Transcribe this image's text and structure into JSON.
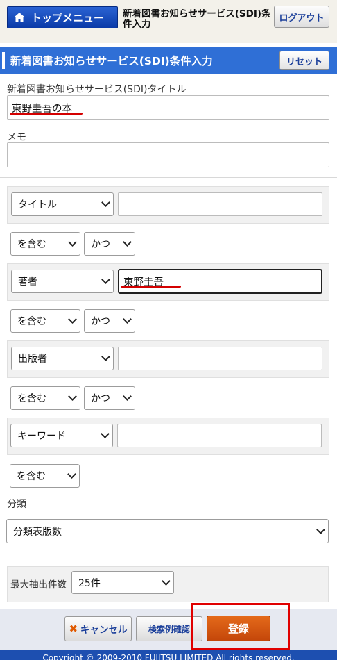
{
  "header": {
    "top_menu_label": "トップメニュー",
    "page_heading": "新着図書お知らせサービス(SDI)条件入力",
    "logout_label": "ログアウト"
  },
  "section": {
    "title": "新着図書お知らせサービス(SDI)条件入力",
    "reset_label": "リセット"
  },
  "form": {
    "title_label": "新着図書お知らせサービス(SDI)タイトル",
    "title_value": "東野圭吾の本",
    "memo_label": "メモ",
    "memo_value": "",
    "conditions": [
      {
        "field": "タイトル",
        "value": "",
        "match": "を含む",
        "operator": "かつ"
      },
      {
        "field": "著者",
        "value": "東野圭吾",
        "match": "を含む",
        "operator": "かつ"
      },
      {
        "field": "出版者",
        "value": "",
        "match": "を含む",
        "operator": "かつ"
      },
      {
        "field": "キーワード",
        "value": "",
        "match": "を含む"
      }
    ],
    "classification_label": "分類",
    "classification_value": "分類表版数",
    "max_results_label": "最大抽出件数",
    "max_results_value": "25件"
  },
  "actions": {
    "cancel_label": "キャンセル",
    "example_label": "検索例確認",
    "register_label": "登録"
  },
  "footer": {
    "copyright": "Copyright © 2009-2010 FUJITSU LIMITED All rights reserved."
  },
  "colors": {
    "header_blue": "#2f6fd6",
    "register_orange": "#d4570f",
    "annotation_red": "#e00000"
  }
}
